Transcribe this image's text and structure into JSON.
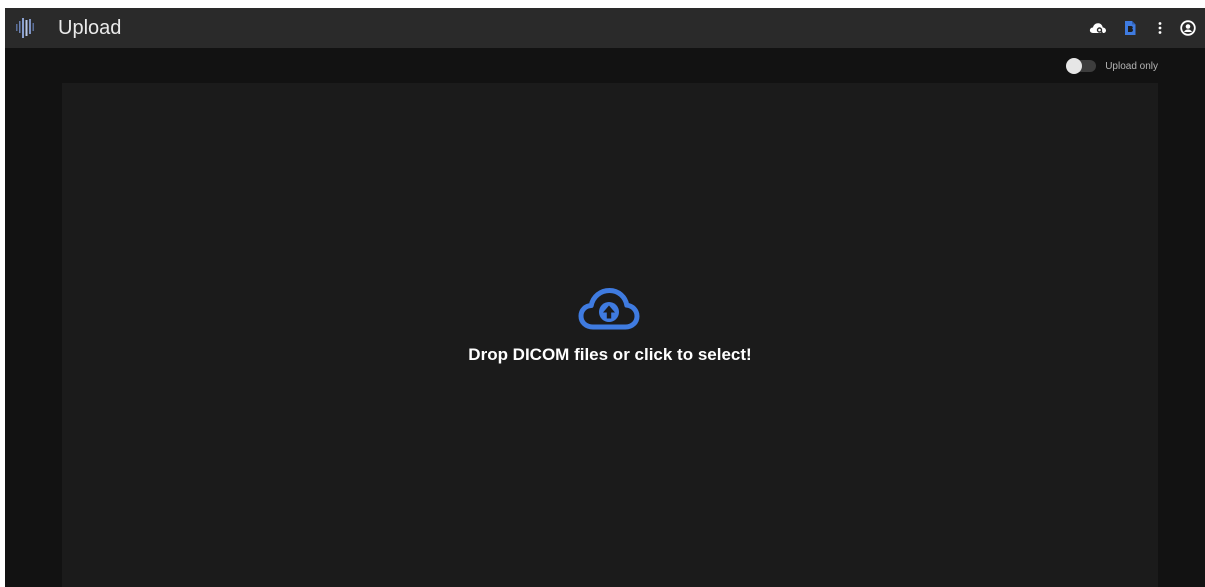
{
  "header": {
    "title": "Upload",
    "logo_icon": "waveform-logo-icon",
    "actions": [
      {
        "icon": "cloud-search-icon"
      },
      {
        "icon": "file-icon"
      },
      {
        "icon": "more-vertical-icon"
      },
      {
        "icon": "account-circle-icon"
      }
    ]
  },
  "options": {
    "upload_only_label": "Upload only",
    "upload_only_enabled": false
  },
  "drop_zone": {
    "icon": "cloud-upload-icon",
    "text": "Drop DICOM files or click to select!"
  },
  "colors": {
    "accent": "#3f7be0",
    "background": "#121212",
    "app_bar": "#2a2a2a",
    "drop_zone": "#1b1b1b"
  }
}
